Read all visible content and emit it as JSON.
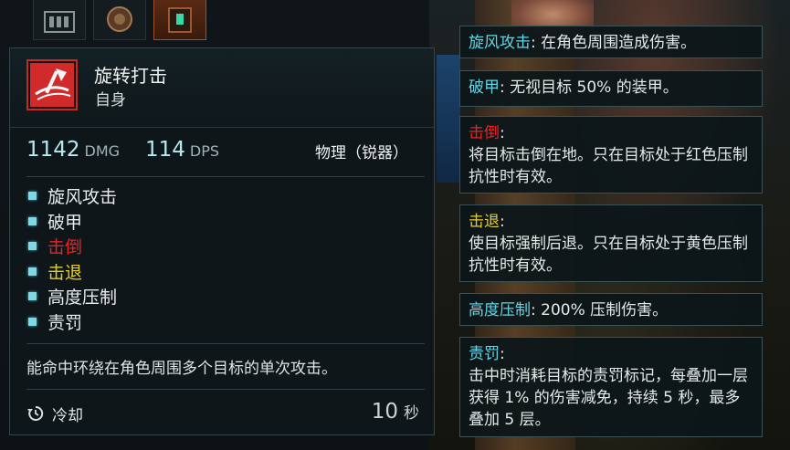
{
  "skill": {
    "name": "旋转打击",
    "target": "自身",
    "dmg_value": "1142",
    "dmg_unit": "DMG",
    "dps_value": "114",
    "dps_unit": "DPS",
    "damage_type": "物理（锐器）",
    "description": "能命中环绕在角色周围多个目标的单次攻击。",
    "cooldown_label": "冷却",
    "cooldown_value": "10",
    "cooldown_unit": "秒"
  },
  "effects": [
    {
      "label": "旋风攻击",
      "color": "#e9ecec"
    },
    {
      "label": "破甲",
      "color": "#e9ecec"
    },
    {
      "label": "击倒",
      "color": "#ee2222"
    },
    {
      "label": "击退",
      "color": "#e6cf24"
    },
    {
      "label": "高度压制",
      "color": "#e9ecec"
    },
    {
      "label": "责罚",
      "color": "#e9ecec"
    }
  ],
  "keywords": [
    {
      "name": "旋风攻击",
      "sep": ": ",
      "text": "在角色周围造成伤害。",
      "color": "#62d6e6"
    },
    {
      "name": "破甲",
      "sep": ": ",
      "text": "无视目标 50% 的装甲。",
      "color": "#62d6e6"
    },
    {
      "name": "击倒",
      "sep": ":",
      "text": "将目标击倒在地。只在目标处于红色压制抗性时有效。",
      "color": "#ee2222"
    },
    {
      "name": "击退",
      "sep": ":",
      "text": "使目标强制后退。只在目标处于黄色压制抗性时有效。",
      "color": "#e6cf24"
    },
    {
      "name": "高度压制",
      "sep": ": ",
      "text": "200% 压制伤害。",
      "color": "#62d6e6"
    },
    {
      "name": "责罚",
      "sep": ":",
      "text": "击中时消耗目标的责罚标记，每叠加一层获得 1% 的伤害减免，持续 5 秒，最多叠加 5 层。",
      "color": "#62d6e6"
    }
  ],
  "icons": {
    "skill": "red-axe-swirl-icon",
    "cooldown": "cooldown-icon"
  },
  "colors": {
    "accent_cyan": "#62d6e6",
    "red": "#ee2222",
    "yellow": "#e6cf24",
    "panel_border": "#34464b"
  }
}
